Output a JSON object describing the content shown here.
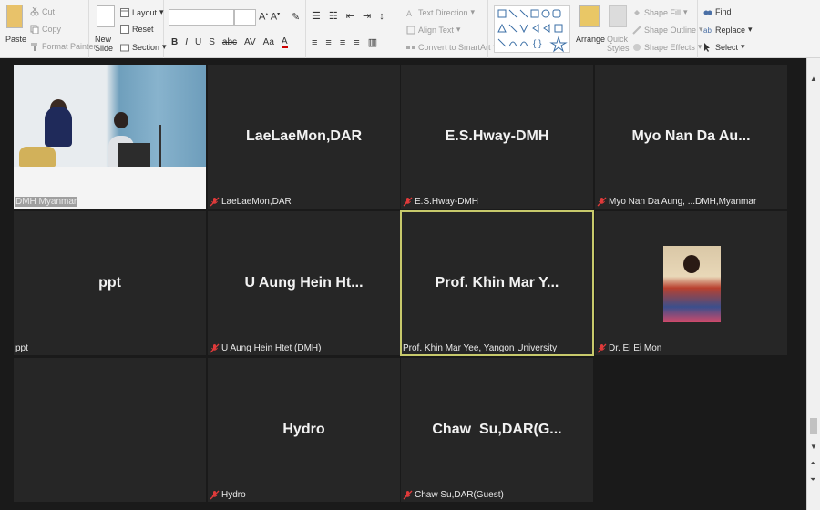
{
  "ribbon": {
    "clipboard": {
      "paste": "Paste",
      "cut": "Cut",
      "copy": "Copy",
      "format_painter": "Format Painter"
    },
    "slides": {
      "new_slide": "New Slide",
      "layout": "Layout",
      "reset": "Reset",
      "section": "Section"
    },
    "paragraph": {
      "text_direction": "Text Direction",
      "align_text": "Align Text",
      "convert_smartart": "Convert to SmartArt"
    },
    "drawing": {
      "arrange": "Arrange",
      "quick_styles": "Quick Styles",
      "shape_fill": "Shape Fill",
      "shape_outline": "Shape Outline",
      "shape_effects": "Shape Effects"
    },
    "editing": {
      "find": "Find",
      "replace": "Replace",
      "select": "Select"
    }
  },
  "gallery": {
    "tiles": [
      {
        "name": "",
        "label": "DMH Myanmar",
        "muted": false,
        "type": "camera"
      },
      {
        "name": "LaeLaeMon,DAR",
        "label": "LaeLaeMon,DAR",
        "muted": true,
        "type": "name"
      },
      {
        "name": "E.S.Hway-DMH",
        "label": "E.S.Hway-DMH",
        "muted": true,
        "type": "name"
      },
      {
        "name": "Myo Nan Da Au...",
        "label": "Myo Nan Da Aung, ...DMH,Myanmar",
        "muted": true,
        "type": "name"
      },
      {
        "name": "ppt",
        "label": "ppt",
        "muted": false,
        "type": "name"
      },
      {
        "name": "U Aung Hein Ht...",
        "label": "U Aung Hein Htet (DMH)",
        "muted": true,
        "type": "name"
      },
      {
        "name": "Prof. Khin Mar Y...",
        "label": "Prof. Khin Mar Yee, Yangon University",
        "muted": false,
        "type": "name",
        "active": true
      },
      {
        "name": "",
        "label": "Dr. Ei Ei Mon",
        "muted": true,
        "type": "photo"
      },
      {
        "name": "",
        "label": "",
        "muted": false,
        "type": "empty"
      },
      {
        "name": "Hydro",
        "label": "Hydro",
        "muted": true,
        "type": "name"
      },
      {
        "name": "Chaw  Su,DAR(G...",
        "label": "Chaw Su,DAR(Guest)",
        "muted": true,
        "type": "name"
      }
    ]
  },
  "colors": {
    "active_outline": "#c7c96b",
    "muted_icon": "#e03a3a",
    "tile_bg": "#262626"
  }
}
